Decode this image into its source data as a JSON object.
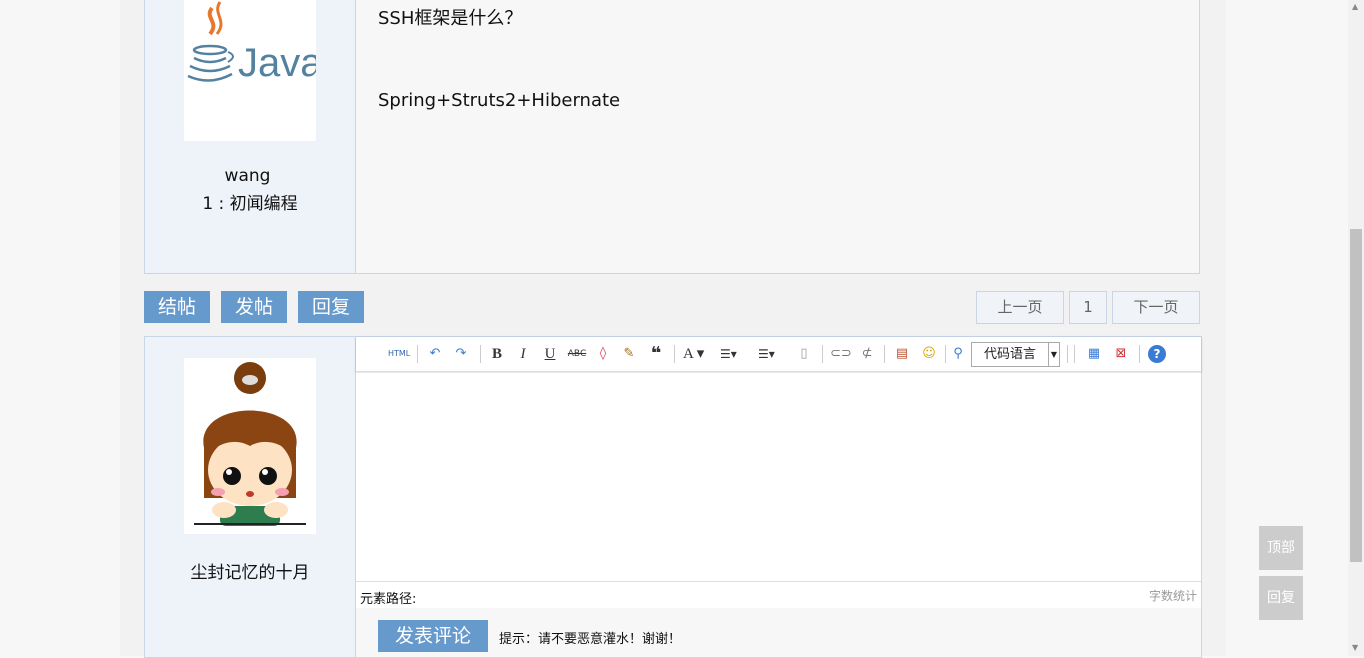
{
  "post": {
    "author_name": "wang",
    "author_level": "1 : 初闻编程",
    "avatar_text": "Java",
    "line1": "SSH框架是什么？",
    "line2": "Spring+Struts2+Hibernate"
  },
  "actions": {
    "close_label": "结帖",
    "new_label": "发帖",
    "reply_label": "回复"
  },
  "pager": {
    "prev": "上一页",
    "page": "1",
    "next": "下一页"
  },
  "reply": {
    "author_name": "尘封记忆的十月"
  },
  "editor": {
    "toolbar": {
      "html": "HTML",
      "code_language": "代码语言"
    },
    "path_label": "元素路径:",
    "word_count": "字数统计",
    "submit_label": "发表评论",
    "hint": "提示：请不要恶意灌水！谢谢！"
  },
  "float": {
    "top": "顶部",
    "reply": "回复"
  },
  "colors": {
    "accent": "#6699cc",
    "panel": "#eef3fa",
    "border": "#c8d6e8"
  }
}
